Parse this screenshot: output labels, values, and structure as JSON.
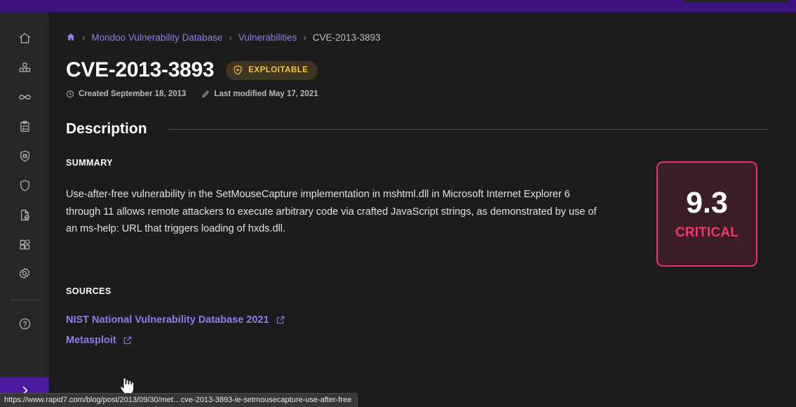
{
  "topbar": {
    "search_placeholder": ""
  },
  "sidebar": {
    "items": [
      {
        "name": "home",
        "label": "Home"
      },
      {
        "name": "fleet",
        "label": "Fleet"
      },
      {
        "name": "integrations-infinity",
        "label": "CI/CD"
      },
      {
        "name": "policies",
        "label": "Policies"
      },
      {
        "name": "vulnerabilities",
        "label": "Vulnerabilities"
      },
      {
        "name": "security",
        "label": "Security"
      },
      {
        "name": "reports",
        "label": "Reports"
      },
      {
        "name": "add-ons",
        "label": "Add-ons"
      },
      {
        "name": "settings",
        "label": "Settings"
      },
      {
        "name": "help",
        "label": "Help"
      }
    ],
    "expand_label": "Expand navigation"
  },
  "breadcrumb": {
    "home_label": "Home",
    "separator": "›",
    "items": [
      {
        "label": "Mondoo Vulnerability Database",
        "link": true
      },
      {
        "label": "Vulnerabilities",
        "link": true
      },
      {
        "label": "CVE-2013-3893",
        "link": false
      }
    ]
  },
  "header": {
    "title": "CVE-2013-3893",
    "badge": {
      "label": "EXPLOITABLE",
      "icon": "shield-x-icon",
      "color": "#f5c542",
      "background": "#3d3520"
    },
    "created": "Created September 18, 2013",
    "modified": "Last modified May 17, 2021"
  },
  "description": {
    "section_title": "Description",
    "summary_label": "SUMMARY",
    "summary_text": "Use-after-free vulnerability in the SetMouseCapture implementation in mshtml.dll in Microsoft Internet Explorer 6 through 11 allows remote attackers to execute arbitrary code via crafted JavaScript strings, as demonstrated by use of an ms-help: URL that triggers loading of hxds.dll."
  },
  "score": {
    "value": "9.3",
    "severity": "CRITICAL",
    "accent_color": "#e8336d",
    "background_color": "#3a1d25"
  },
  "sources": {
    "label": "SOURCES",
    "links": [
      {
        "label": "NIST National Vulnerability Database 2021",
        "icon": "external-link-icon"
      },
      {
        "label": "Metasploit",
        "icon": "external-link-icon"
      }
    ]
  },
  "statusbar": {
    "url": "https://www.rapid7.com/blog/post/2013/09/30/met…cve-2013-3893-ie-setmousecapture-use-after-free"
  },
  "colors": {
    "brand_purple": "#3d1280",
    "link": "#8a7fe8",
    "page_bg": "#1c1c1c",
    "sidebar_bg": "#262626"
  }
}
